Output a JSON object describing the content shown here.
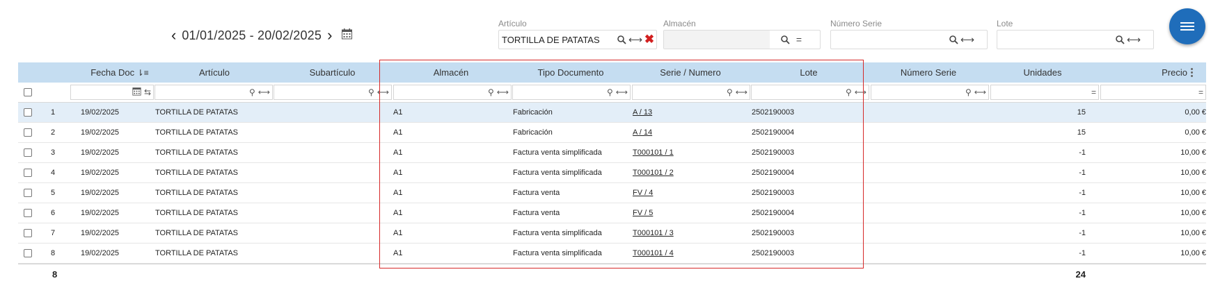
{
  "date_range": "01/01/2025 - 20/02/2025",
  "filters": {
    "articulo": {
      "label": "Artículo",
      "value": "TORTILLA DE PATATAS"
    },
    "almacen": {
      "label": "Almacén",
      "value": "",
      "op": "="
    },
    "numero_serie": {
      "label": "Número Serie",
      "value": ""
    },
    "lote": {
      "label": "Lote",
      "value": ""
    }
  },
  "columns": {
    "fecha": "Fecha Doc",
    "articulo": "Artículo",
    "subarticulo": "Subartículo",
    "almacen": "Almacén",
    "tipo": "Tipo Documento",
    "serie": "Serie / Numero",
    "lote": "Lote",
    "numero_serie": "Número Serie",
    "unidades": "Unidades",
    "precio": "Precio"
  },
  "filter_ops": {
    "eq": "="
  },
  "rows": [
    {
      "n": "1",
      "fecha": "19/02/2025",
      "articulo": "TORTILLA DE PATATAS",
      "almacen": "A1",
      "tipo": "Fabricación",
      "serie": "A / 13",
      "lote": "2502190003",
      "unidades": "15",
      "precio": "0,00 €"
    },
    {
      "n": "2",
      "fecha": "19/02/2025",
      "articulo": "TORTILLA DE PATATAS",
      "almacen": "A1",
      "tipo": "Fabricación",
      "serie": "A / 14",
      "lote": "2502190004",
      "unidades": "15",
      "precio": "0,00 €"
    },
    {
      "n": "3",
      "fecha": "19/02/2025",
      "articulo": "TORTILLA DE PATATAS",
      "almacen": "A1",
      "tipo": "Factura venta simplificada",
      "serie": "T000101 / 1",
      "lote": "2502190003",
      "unidades": "-1",
      "precio": "10,00 €"
    },
    {
      "n": "4",
      "fecha": "19/02/2025",
      "articulo": "TORTILLA DE PATATAS",
      "almacen": "A1",
      "tipo": "Factura venta simplificada",
      "serie": "T000101 / 2",
      "lote": "2502190004",
      "unidades": "-1",
      "precio": "10,00 €"
    },
    {
      "n": "5",
      "fecha": "19/02/2025",
      "articulo": "TORTILLA DE PATATAS",
      "almacen": "A1",
      "tipo": "Factura venta",
      "serie": "FV / 4",
      "lote": "2502190003",
      "unidades": "-1",
      "precio": "10,00 €"
    },
    {
      "n": "6",
      "fecha": "19/02/2025",
      "articulo": "TORTILLA DE PATATAS",
      "almacen": "A1",
      "tipo": "Factura venta",
      "serie": "FV / 5",
      "lote": "2502190004",
      "unidades": "-1",
      "precio": "10,00 €"
    },
    {
      "n": "7",
      "fecha": "19/02/2025",
      "articulo": "TORTILLA DE PATATAS",
      "almacen": "A1",
      "tipo": "Factura venta simplificada",
      "serie": "T000101 / 3",
      "lote": "2502190003",
      "unidades": "-1",
      "precio": "10,00 €"
    },
    {
      "n": "8",
      "fecha": "19/02/2025",
      "articulo": "TORTILLA DE PATATAS",
      "almacen": "A1",
      "tipo": "Factura venta simplificada",
      "serie": "T000101 / 4",
      "lote": "2502190003",
      "unidades": "-1",
      "precio": "10,00 €"
    }
  ],
  "footer": {
    "count": "8",
    "unidades_total": "24"
  }
}
